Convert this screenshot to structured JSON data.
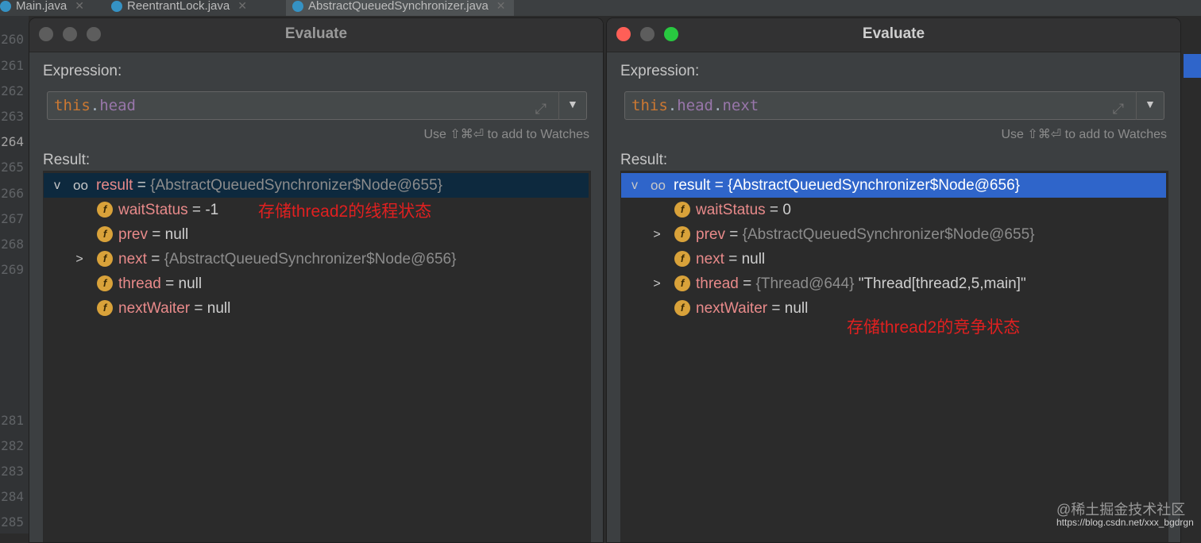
{
  "tabs": [
    {
      "label": "Main.java",
      "close": "✕"
    },
    {
      "label": "ReentrantLock.java",
      "close": "✕"
    },
    {
      "label": "AbstractQueuedSynchronizer.java",
      "close": "✕"
    }
  ],
  "line_numbers": {
    "top": [
      "260",
      "261",
      "262",
      "263",
      "264",
      "265",
      "266",
      "267",
      "268",
      "269"
    ],
    "bottom": [
      "281",
      "282",
      "283",
      "284",
      "285"
    ]
  },
  "colors": {
    "close": "#ff5f57",
    "minimize": "#febc2e",
    "zoom": "#28c840",
    "inactive": "#5d5d5d",
    "selection": "#2f65ca"
  },
  "dialogs": [
    {
      "title": "Evaluate",
      "expression_label": "Expression:",
      "expression": {
        "kw": "this",
        "dot1": ".",
        "f1": "head",
        "dot2": "",
        "f2": ""
      },
      "hint": "Use ⇧⌘⏎ to add to Watches",
      "result_label": "Result:",
      "root": {
        "name": "result",
        "eq": " = ",
        "value": "{AbstractQueuedSynchronizer$Node@655}"
      },
      "fields": [
        {
          "name": "waitStatus",
          "eq": " = ",
          "gray": "",
          "value": "-1"
        },
        {
          "name": "prev",
          "eq": " = ",
          "gray": "",
          "value": "null"
        },
        {
          "name": "next",
          "eq": " = ",
          "gray": "{AbstractQueuedSynchronizer$Node@656}",
          "value": ""
        },
        {
          "name": "thread",
          "eq": " = ",
          "gray": "",
          "value": "null"
        },
        {
          "name": "nextWaiter",
          "eq": " = ",
          "gray": "",
          "value": "null"
        }
      ],
      "annotation": "存储thread2的线程状态"
    },
    {
      "title": "Evaluate",
      "expression_label": "Expression:",
      "expression": {
        "kw": "this",
        "dot1": ".",
        "f1": "head",
        "dot2": ".",
        "f2": "next"
      },
      "hint": "Use ⇧⌘⏎ to add to Watches",
      "result_label": "Result:",
      "root": {
        "name": "result",
        "eq": " = ",
        "value": "{AbstractQueuedSynchronizer$Node@656}"
      },
      "fields": [
        {
          "name": "waitStatus",
          "eq": " = ",
          "gray": "",
          "value": "0"
        },
        {
          "name": "prev",
          "eq": " = ",
          "gray": "{AbstractQueuedSynchronizer$Node@655}",
          "value": ""
        },
        {
          "name": "next",
          "eq": " = ",
          "gray": "",
          "value": "null"
        },
        {
          "name": "thread",
          "eq": " = ",
          "gray": "{Thread@644}",
          "value": " \"Thread[thread2,5,main]\""
        },
        {
          "name": "nextWaiter",
          "eq": " = ",
          "gray": "",
          "value": "null"
        }
      ],
      "annotation": "存储thread2的竞争状态"
    }
  ],
  "icons": {
    "field": "f",
    "watch": "oo",
    "expand": "⤢",
    "dropdown": "▼",
    "caret_open": "v",
    "caret_closed": ">"
  },
  "watermark": {
    "line1": "@稀土掘金技术社区",
    "line2": "https://blog.csdn.net/xxx_bgdrgn"
  }
}
